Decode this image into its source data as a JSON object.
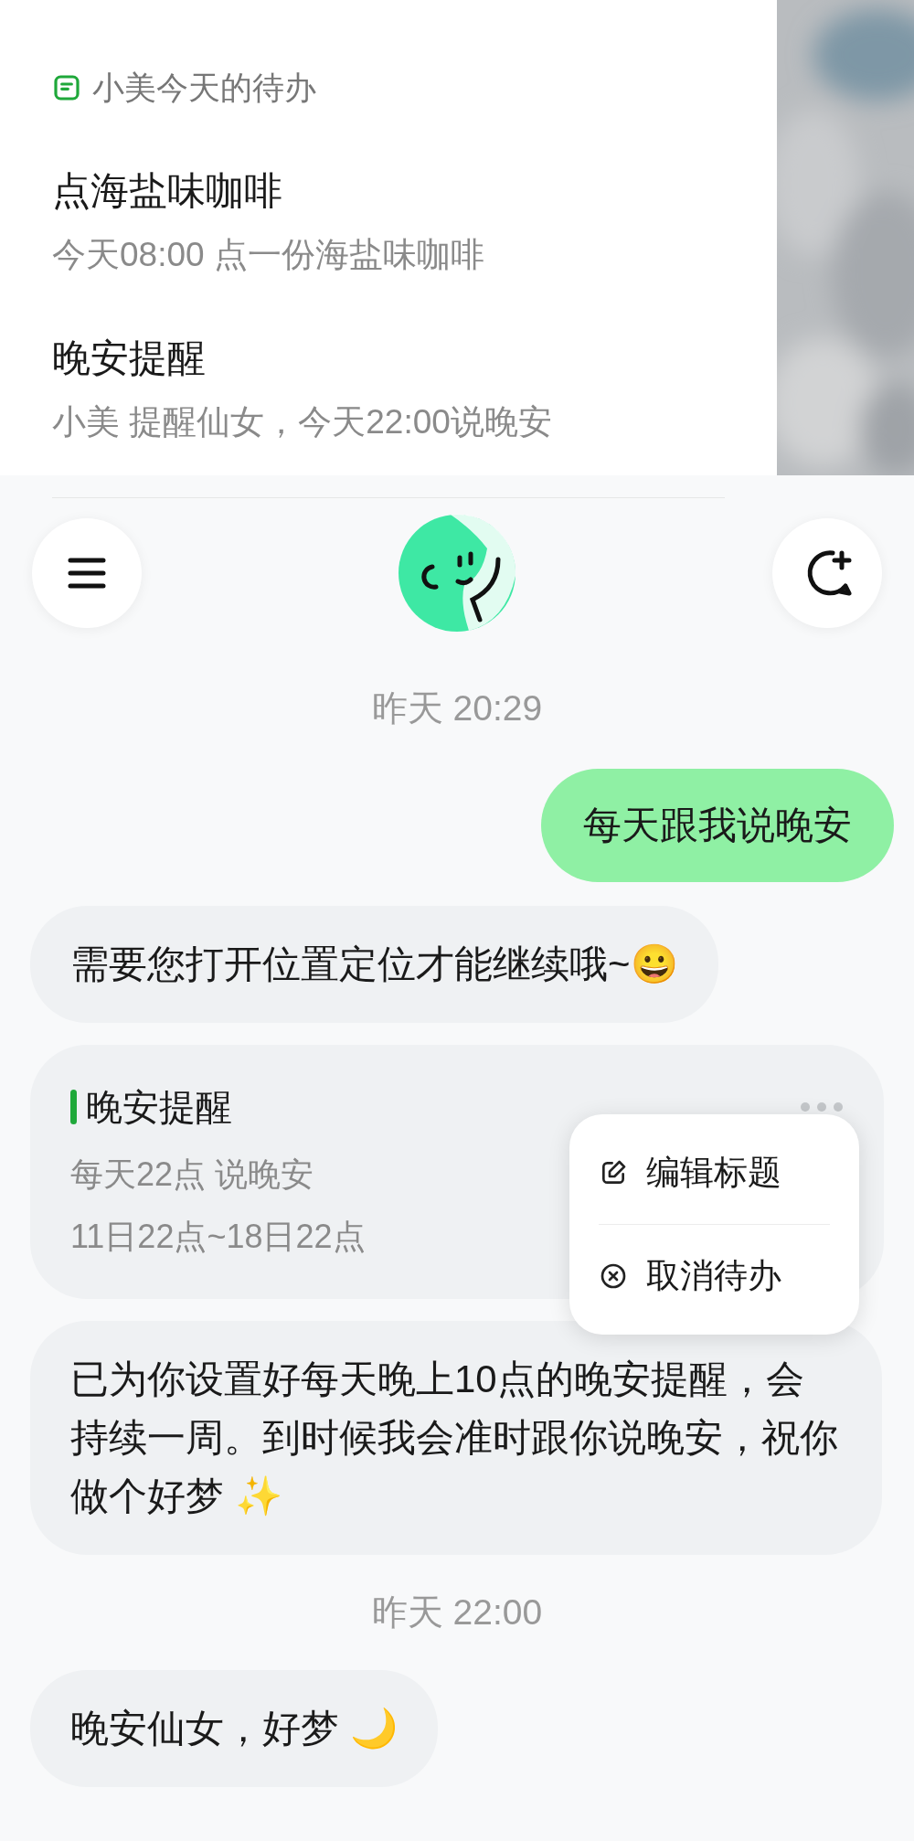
{
  "todo_panel": {
    "title": "小美今天的待办",
    "items": [
      {
        "title": "点海盐味咖啡",
        "detail": "今天08:00 点一份海盐味咖啡"
      },
      {
        "title": "晚安提醒",
        "detail": "小美 提醒仙女，今天22:00说晚安"
      }
    ]
  },
  "chat": {
    "messages": [
      {
        "kind": "time",
        "text": "昨天 20:29"
      },
      {
        "kind": "user",
        "text": "每天跟我说晚安"
      },
      {
        "kind": "bot",
        "text": "需要您打开位置定位才能继续哦~😀"
      },
      {
        "kind": "card",
        "title": "晚安提醒",
        "lines": [
          "每天22点 说晚安",
          "11日22点~18日22点"
        ],
        "menu": {
          "open": true,
          "items": [
            {
              "kind": "edit",
              "label": "编辑标题"
            },
            {
              "kind": "cancel",
              "label": "取消待办"
            }
          ]
        }
      },
      {
        "kind": "bot",
        "text": "已为你设置好每天晚上10点的晚安提醒，会持续一周。到时候我会准时跟你说晚安，祝你做个好梦 ✨"
      },
      {
        "kind": "time",
        "text": "昨天 22:00"
      },
      {
        "kind": "bot",
        "text": "晚安仙女，好梦 🌙"
      }
    ]
  }
}
